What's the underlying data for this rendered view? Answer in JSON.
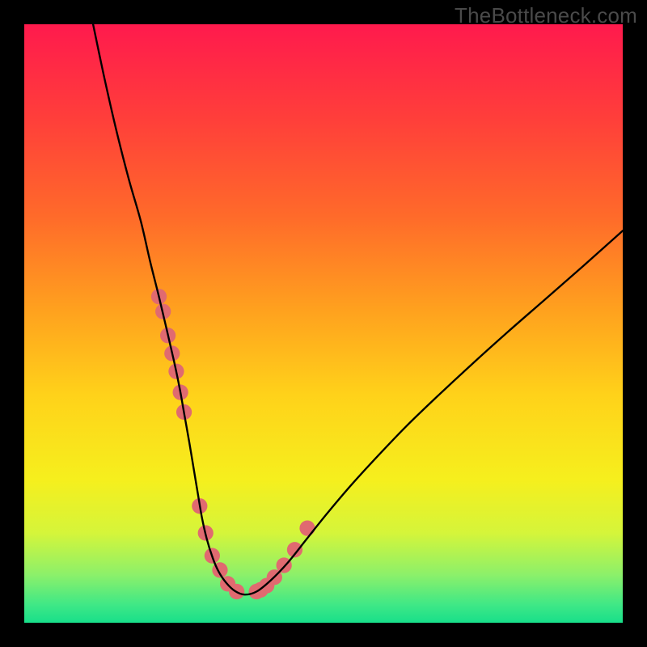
{
  "watermark": "TheBottleneck.com",
  "gradient": {
    "stops": [
      {
        "offset": 0.0,
        "color": "#ff1a4d"
      },
      {
        "offset": 0.16,
        "color": "#ff3f3a"
      },
      {
        "offset": 0.32,
        "color": "#ff6a2a"
      },
      {
        "offset": 0.48,
        "color": "#ffa21e"
      },
      {
        "offset": 0.62,
        "color": "#ffd21a"
      },
      {
        "offset": 0.76,
        "color": "#f6ef1d"
      },
      {
        "offset": 0.85,
        "color": "#d5f53a"
      },
      {
        "offset": 0.92,
        "color": "#8cf06a"
      },
      {
        "offset": 0.97,
        "color": "#3fe886"
      },
      {
        "offset": 1.0,
        "color": "#18df8a"
      }
    ]
  },
  "chart_data": {
    "type": "line",
    "title": "",
    "xlabel": "",
    "ylabel": "",
    "xlim": [
      0,
      1000
    ],
    "ylim": [
      0,
      1000
    ],
    "series": [
      {
        "name": "bottleneck-curve",
        "x": [
          115,
          135,
          155,
          175,
          195,
          210,
          225,
          238,
          250,
          260,
          268,
          276,
          283,
          290,
          297,
          305,
          315,
          325,
          338,
          352,
          368,
          388,
          412,
          440,
          472,
          508,
          548,
          592,
          640,
          692,
          748,
          808,
          870,
          935,
          1000
        ],
        "values": [
          1000,
          905,
          818,
          740,
          670,
          605,
          545,
          490,
          438,
          390,
          345,
          300,
          258,
          216,
          175,
          140,
          108,
          85,
          66,
          53,
          47,
          52,
          71,
          100,
          140,
          185,
          232,
          280,
          330,
          380,
          432,
          486,
          540,
          597,
          655
        ]
      }
    ],
    "markers": {
      "name": "highlighted-points",
      "color": "#e06a70",
      "radius": 13,
      "x": [
        225,
        232,
        240,
        247,
        254,
        261,
        267,
        293,
        303,
        314,
        327,
        340,
        355,
        388,
        395,
        405,
        418,
        434,
        452,
        473
      ],
      "values": [
        545,
        520,
        480,
        450,
        420,
        385,
        352,
        195,
        150,
        112,
        88,
        65,
        52,
        52,
        55,
        62,
        76,
        96,
        122,
        158
      ]
    }
  }
}
